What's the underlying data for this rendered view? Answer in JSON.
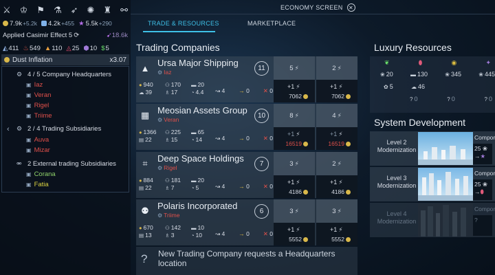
{
  "topbar": {
    "icons": [
      "sword-icon",
      "empire-icon",
      "flag-icon",
      "flask-icon",
      "ship-icon",
      "star-burst-icon",
      "trophy-icon",
      "handshake-icon"
    ],
    "title": "ECONOMY SCREEN"
  },
  "resources_row1": [
    {
      "icon": "dust-icon",
      "color": "#d9b84a",
      "value": "7.9k",
      "delta": "+5.2k"
    },
    {
      "icon": "science-icon",
      "color": "#7fb2e8",
      "value": "4.2k",
      "delta": "+455"
    },
    {
      "icon": "influence-icon",
      "color": "#b56ee8",
      "value": "5.5k",
      "delta": "+290"
    }
  ],
  "effect": {
    "label": "Applied Casimir Effect 5",
    "value": "18.6k"
  },
  "resources_row2": [
    {
      "icon": "titanium-icon",
      "color": "#8fb0e0",
      "value": "411"
    },
    {
      "icon": "hyperium-icon",
      "color": "#e05a4a",
      "value": "549"
    },
    {
      "icon": "antimatter-icon",
      "color": "#e8a040",
      "value": "110"
    },
    {
      "icon": "orichalcum-icon",
      "color": "#e04a6a",
      "value": "25"
    },
    {
      "icon": "adamantian-icon",
      "color": "#a07ad8",
      "value": "10"
    },
    {
      "icon": "strategic-icon",
      "color": "#6adf6a",
      "value": "5"
    }
  ],
  "inflation": {
    "label": "Dust Inflation",
    "value": "x3.07"
  },
  "tree": {
    "headquarters": {
      "label": "4 / 5 Company Headquarters",
      "items": [
        {
          "name": "Iaz",
          "color": "red"
        },
        {
          "name": "Veran",
          "color": "red"
        },
        {
          "name": "Rigel",
          "color": "red"
        },
        {
          "name": "Triime",
          "color": "red"
        }
      ]
    },
    "subsidiaries": {
      "label": "2 / 4 Trading Subsidiaries",
      "items": [
        {
          "name": "Auva",
          "color": "red"
        },
        {
          "name": "Mizar",
          "color": "red"
        }
      ]
    },
    "external": {
      "label": "2 External trading Subsidiaries",
      "items": [
        {
          "name": "Corana",
          "color": "green"
        },
        {
          "name": "Fatia",
          "color": "yellow"
        }
      ]
    }
  },
  "tabs": {
    "trade": "TRADE & RESOURCES",
    "market": "MARKETPLACE"
  },
  "trading": {
    "title": "Trading Companies",
    "companies": [
      {
        "name": "Ursa Major Shipping",
        "owner": "Iaz",
        "badge": "11",
        "icon": "fire-icon",
        "stats": [
          "940",
          "170",
          "20",
          "39",
          "17",
          "4.4"
        ],
        "flow": [
          "4",
          "0",
          "0"
        ],
        "cells": [
          {
            "top": "5",
            "plus": "+1",
            "value": "7062",
            "value_color": "normal"
          },
          {
            "top": "2",
            "plus": "+1",
            "value": "7062",
            "value_color": "normal"
          }
        ]
      },
      {
        "name": "Meosian Assets Group",
        "owner": "Veran",
        "badge": "10",
        "icon": "grid-icon",
        "stats": [
          "1366",
          "225",
          "65",
          "22",
          "15",
          "14"
        ],
        "flow": [
          "4",
          "0",
          "0"
        ],
        "cells": [
          {
            "top": "8",
            "plus": "+1",
            "value": "16519",
            "value_color": "red"
          },
          {
            "top": "4",
            "plus": "+1",
            "value": "16519",
            "value_color": "red"
          }
        ]
      },
      {
        "name": "Deep Space Holdings",
        "owner": "Rigel",
        "badge": "7",
        "icon": "crop-icon",
        "stats": [
          "884",
          "181",
          "20",
          "22",
          "7",
          "5"
        ],
        "flow": [
          "4",
          "0",
          "0"
        ],
        "cells": [
          {
            "top": "3",
            "plus": "+1",
            "value": "4186",
            "value_color": "normal"
          },
          {
            "top": "2",
            "plus": "+1",
            "value": "4186",
            "value_color": "normal"
          }
        ]
      },
      {
        "name": "Polaris Incorporated",
        "owner": "Triime",
        "badge": "6",
        "icon": "robot-icon",
        "stats": [
          "670",
          "142",
          "10",
          "13",
          "3",
          "10"
        ],
        "flow": [
          "4",
          "0",
          "0"
        ],
        "cells": [
          {
            "top": "3",
            "plus": "+1",
            "value": "5552",
            "value_color": "normal"
          },
          {
            "top": "3",
            "plus": "+1",
            "value": "5552",
            "value_color": "normal"
          }
        ]
      }
    ],
    "new_request": "New Trading Company requests a Headquarters location"
  },
  "luxury": {
    "title": "Luxury Resources",
    "row1": [
      {
        "icon": "leaf-icon",
        "color": "#6adf6a",
        "value": "20"
      },
      {
        "icon": "capsule-icon",
        "color": "#e05a7a",
        "value": "130"
      },
      {
        "icon": "orb-icon",
        "color": "#e0c040",
        "value": "345"
      },
      {
        "icon": "sparkle-icon",
        "color": "#a07ad8",
        "value": "445"
      }
    ],
    "row2": [
      {
        "value": "5"
      },
      {
        "value": "46"
      }
    ],
    "row3": [
      {
        "value": "0"
      },
      {
        "value": "0"
      },
      {
        "value": "0"
      }
    ]
  },
  "system": {
    "title": "System Development",
    "levels": [
      {
        "label": "Level 2 Modernization",
        "compo": "Compor",
        "cost": "25",
        "active": true
      },
      {
        "label": "Level 3 Modernization",
        "compo": "Compor",
        "cost": "25",
        "active": true
      },
      {
        "label": "Level 4 Modernization",
        "compo": "Compor",
        "cost": "?",
        "active": false
      }
    ]
  }
}
